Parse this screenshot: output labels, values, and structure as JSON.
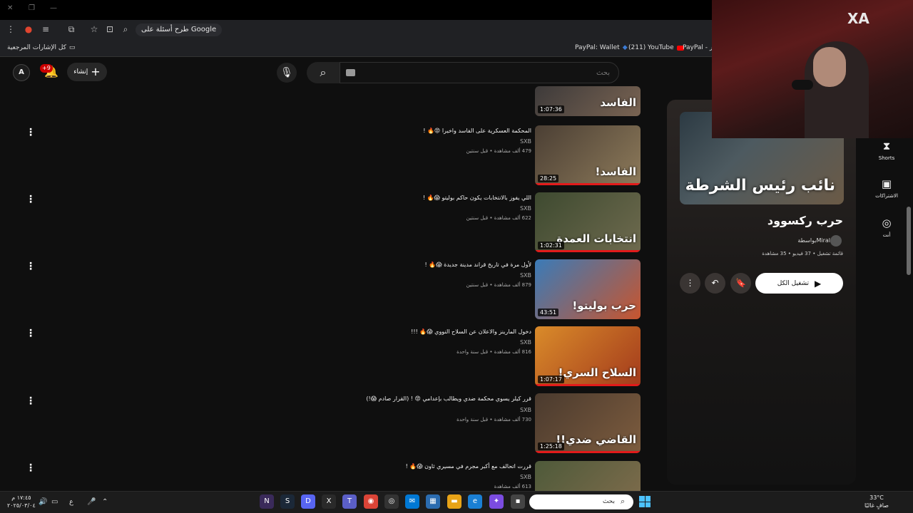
{
  "browser": {
    "address_chip": "طرح أسئلة على Google",
    "bookmarks_all": "كل الإشارات المرجعية",
    "bookmarks": [
      {
        "label": "PayPal: Wallet"
      },
      {
        "label": "(211) YouTube"
      },
      {
        "label": "PayPal - وجر"
      }
    ]
  },
  "masthead": {
    "create_label": "إنشاء",
    "notif_count": "+9",
    "search_placeholder": "بحث",
    "avatar_label": "A"
  },
  "videos": [
    {
      "title": "",
      "channel": "",
      "views": "",
      "age": "",
      "duration": "1:07:36",
      "thumb_text": "الفاسد",
      "thumb_colors": [
        "#3d3a3a",
        "#7a6452"
      ]
    },
    {
      "title": "المحكمة العسكرية على الفاسد واخيرا 😡🔥 !",
      "channel": "SXB",
      "views": "479 ألف مشاهدة",
      "age": "قبل سنتين",
      "duration": "28:25",
      "thumb_text": "الفاسد!",
      "thumb_colors": [
        "#4b3f34",
        "#8d7a5a"
      ]
    },
    {
      "title": "اللي يفوز بالانتخابات يكون حاكم بوليتو 😱🔥 !",
      "channel": "SXB",
      "views": "622 ألف مشاهدة",
      "age": "قبل سنتين",
      "duration": "1:02:31",
      "thumb_text": "انتخابات العمدة",
      "thumb_colors": [
        "#3e4a30",
        "#6e6a4e"
      ]
    },
    {
      "title": "لأول مرة في تاريخ قراند مدينة جديدة 😱🔥 !",
      "channel": "SXB",
      "views": "879 ألف مشاهدة",
      "age": "قبل سنتين",
      "duration": "43:51",
      "thumb_text": "حرب بوليتو!",
      "thumb_colors": [
        "#3a7bb8",
        "#c8552e"
      ]
    },
    {
      "title": "دخول المارينز والاعلان عن السلاح النووي 😱🔥 !!!",
      "channel": "SXB",
      "views": "816 ألف مشاهدة",
      "age": "قبل سنة واحدة",
      "duration": "1:07:17",
      "thumb_text": "السلاح السري!",
      "thumb_colors": [
        "#d98b2a",
        "#a33a1c"
      ]
    },
    {
      "title": "قرر كيلر يسوي محكمة ضدي ويطالب بإعدامي 😡 ! (القرار صادم 😱!)",
      "channel": "SXB",
      "views": "730 ألف مشاهدة",
      "age": "قبل سنة واحدة",
      "duration": "1:25:18",
      "thumb_text": "القاضي ضدي!!",
      "thumb_colors": [
        "#4a3a2e",
        "#7d5c3e"
      ]
    },
    {
      "title": "قررت اتحالف مع أكبر مجرم في مسيري ثاون 😱🔥 !",
      "channel": "SXB",
      "views": "613 ألف مشاهدة",
      "age": "",
      "duration": "",
      "thumb_text": "",
      "thumb_colors": [
        "#4e5a3a",
        "#7a6a4a"
      ]
    }
  ],
  "playlist": {
    "title": "حرب ركسوود",
    "owner": "بواسطةMiral",
    "meta": "قائمة تشغيل • 37 فيديو • 35 مشاهدة",
    "thumb_text": "نائب رئيس الشرطة",
    "play_all": "تشغيل الكل"
  },
  "guide": [
    {
      "icon": "shorts-icon",
      "label": "Shorts"
    },
    {
      "icon": "subscriptions-icon",
      "label": "الاشتراكات"
    },
    {
      "icon": "you-icon",
      "label": "أنت"
    }
  ],
  "webcam": {
    "logo": "XA"
  },
  "taskbar": {
    "time": "١٧:٤٥ م",
    "date": "٢٠٢٥/٠٣/٠٤",
    "lang": "ع",
    "search_placeholder": "بحث",
    "weather_temp": "33°C",
    "weather_desc": "صافٍ غالبًا"
  },
  "colors": {
    "accent_red": "#ff0000",
    "background": "#0f0f0f",
    "windows_blue": "#4cc2ff"
  }
}
